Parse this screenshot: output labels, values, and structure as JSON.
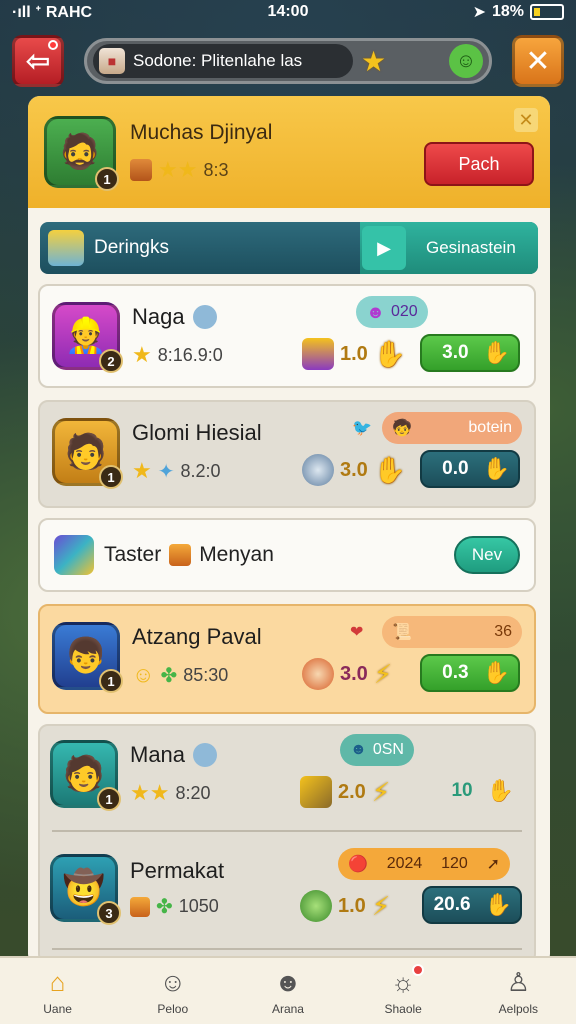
{
  "status": {
    "left": "·ıll ᐩ RAHC",
    "time": "14:00",
    "battery": "18%"
  },
  "top": {
    "search_text": "Sodone: Plitenlahe las"
  },
  "header": {
    "name": "Muchas Djinyal",
    "level": "1",
    "stat": "8:3",
    "push_label": "Pach"
  },
  "section": {
    "title": "Deringks",
    "tab_label": "Gesinastein"
  },
  "cards": [
    {
      "name": "Naga",
      "level": "2",
      "sub": "8:16.9:0",
      "badge": "020",
      "mid": "1.0",
      "btn": "3.0"
    },
    {
      "name": "Glomi Hiesial",
      "level": "1",
      "sub": "8.2:0",
      "badge": "botein",
      "mid": "3.0",
      "btn": "0.0"
    },
    {
      "name": "Atzang Paval",
      "level": "1",
      "sub": "85:30",
      "badge": "36",
      "mid": "3.0",
      "btn": "0.3"
    },
    {
      "name": "Mana",
      "level": "1",
      "sub": "8:20",
      "badge": "0SN",
      "mid": "2.0",
      "btn": "10"
    },
    {
      "name": "Permakat",
      "level": "3",
      "sub": "1050",
      "badge_a": "2024",
      "badge_b": "120",
      "mid": "1.0",
      "btn": "20.6"
    }
  ],
  "tester": {
    "label_a": "Taster",
    "label_b": "Menyan",
    "new_label": "Nev"
  },
  "nav": [
    {
      "label": "Uane",
      "icon": "home-icon"
    },
    {
      "label": "Peloo",
      "icon": "chat-icon"
    },
    {
      "label": "Arana",
      "icon": "hero-icon"
    },
    {
      "label": "Shaole",
      "icon": "shop-icon"
    },
    {
      "label": "Aelpols",
      "icon": "profile-icon"
    }
  ]
}
